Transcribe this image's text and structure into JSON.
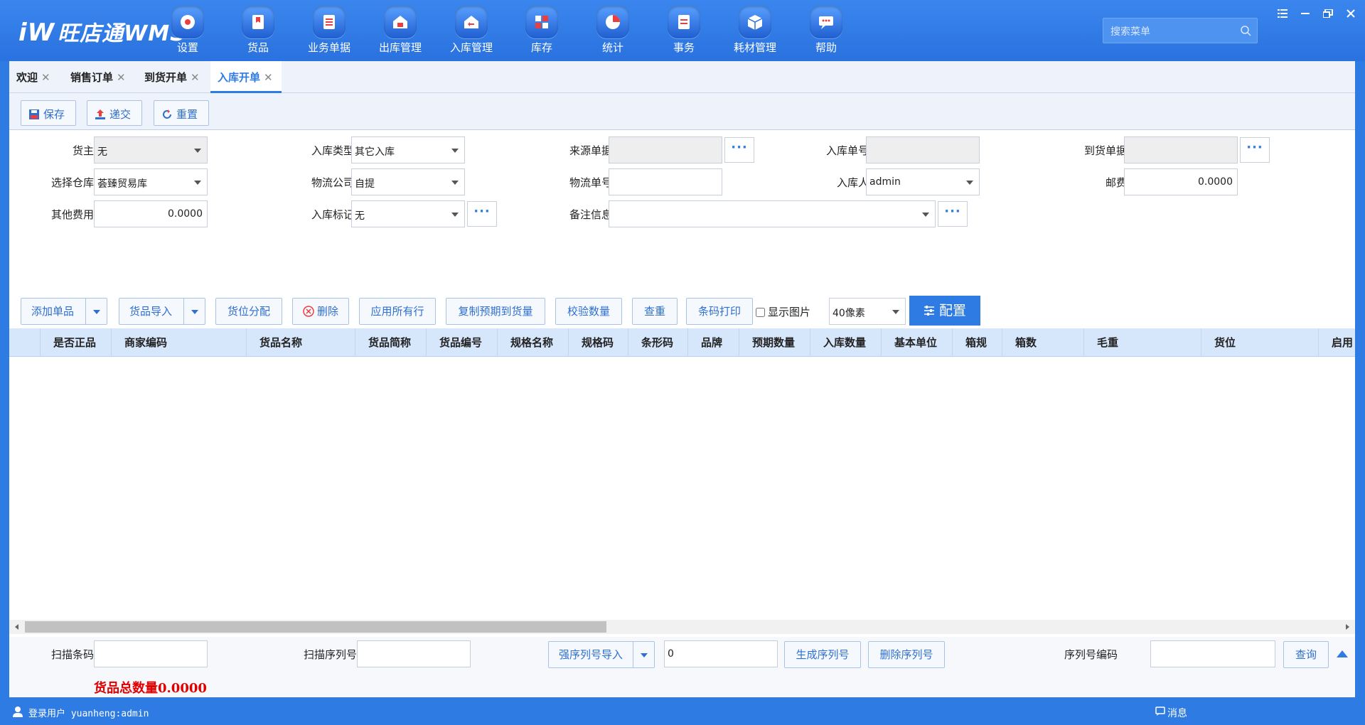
{
  "app": {
    "logo_mark": "iW",
    "logo_text": "旺店通WMS"
  },
  "nav": [
    {
      "label": "设置",
      "icon": "settings-icon"
    },
    {
      "label": "货品",
      "icon": "goods-icon"
    },
    {
      "label": "业务单据",
      "icon": "document-icon"
    },
    {
      "label": "出库管理",
      "icon": "outbound-icon"
    },
    {
      "label": "入库管理",
      "icon": "inbound-icon"
    },
    {
      "label": "库存",
      "icon": "inventory-icon"
    },
    {
      "label": "统计",
      "icon": "pie-chart-icon"
    },
    {
      "label": "事务",
      "icon": "task-icon"
    },
    {
      "label": "耗材管理",
      "icon": "box-icon"
    },
    {
      "label": "帮助",
      "icon": "help-chat-icon"
    }
  ],
  "search": {
    "placeholder": "搜索菜单"
  },
  "tabs": [
    {
      "label": "欢迎",
      "active": false
    },
    {
      "label": "销售订单",
      "active": false
    },
    {
      "label": "到货开单",
      "active": false
    },
    {
      "label": "入库开单",
      "active": true
    }
  ],
  "toolbar": {
    "save": "保存",
    "submit": "递交",
    "reset": "重置"
  },
  "form": {
    "owner_label": "货主",
    "owner_value": "无",
    "inbound_type_label": "入库类型",
    "inbound_type_value": "其它入库",
    "source_doc_label": "来源单据",
    "source_doc_value": "",
    "inbound_no_label": "入库单号",
    "inbound_no_value": "",
    "arrival_doc_label": "到货单据",
    "arrival_doc_value": "",
    "warehouse_label": "选择仓库",
    "warehouse_value": "荟臻贸易库",
    "logistics_company_label": "物流公司",
    "logistics_company_value": "自提",
    "logistics_no_label": "物流单号",
    "logistics_no_value": "",
    "operator_label": "入库人",
    "operator_value": "admin",
    "postage_label": "邮费",
    "postage_value": "0.0000",
    "other_fee_label": "其他费用",
    "other_fee_value": "0.0000",
    "inbound_mark_label": "入库标记",
    "inbound_mark_value": "无",
    "remark_label": "备注信息",
    "remark_value": "",
    "dots": "···"
  },
  "actions": {
    "add_item": "添加单品",
    "import_goods": "货品导入",
    "assign_location": "货位分配",
    "delete": "删除",
    "apply_all": "应用所有行",
    "copy_expected": "复制预期到货量",
    "verify_qty": "校验数量",
    "recheck": "查重",
    "print_barcode": "条码打印",
    "show_image": "显示图片",
    "row_height": "40像素",
    "config": "配置"
  },
  "columns": [
    "是否正品",
    "商家编码",
    "货品名称",
    "货品简称",
    "货品编号",
    "规格名称",
    "规格码",
    "条形码",
    "品牌",
    "预期数量",
    "入库数量",
    "基本单位",
    "箱规",
    "箱数",
    "毛重",
    "货位",
    "启用"
  ],
  "bottom": {
    "scan_barcode_label": "扫描条码",
    "scan_barcode_value": "",
    "scan_serial_label": "扫描序列号",
    "scan_serial_value": "",
    "strong_serial_import": "强序列号导入",
    "serial_count_value": "0",
    "generate_serial": "生成序列号",
    "delete_serial": "删除序列号",
    "serial_code_label": "序列号编码",
    "serial_code_value": "",
    "query": "查询",
    "total_qty": "货品总数量0.0000"
  },
  "status": {
    "login_user": "登录用户 yuanheng:admin",
    "messages": "消息"
  },
  "colors": {
    "primary": "#2e7be4",
    "total_red": "#e00000"
  }
}
